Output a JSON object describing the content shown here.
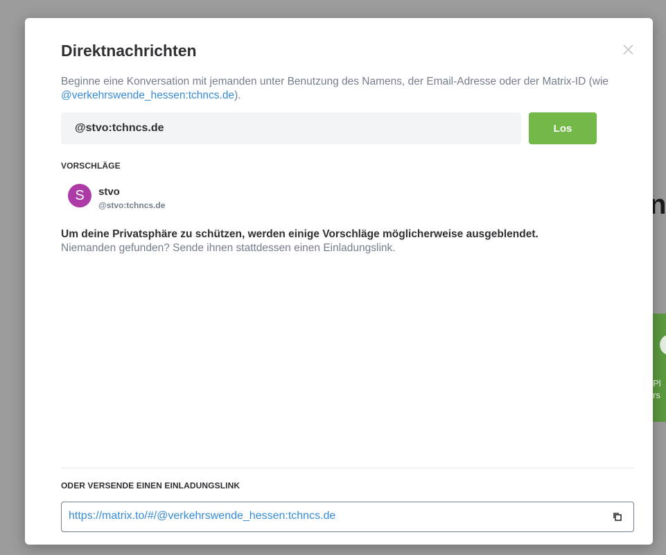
{
  "background": {
    "heading_fragment": "na",
    "card_text_line1": "Pl",
    "card_text_line2": "rs"
  },
  "dialog": {
    "title": "Direktnachrichten",
    "close_icon": "close-icon",
    "description_prefix": "Beginne eine Konversation mit jemanden unter Benutzung des Namens, der Email-Adresse oder der Matrix-ID (wie ",
    "description_example_id": "@verkehrswende_hessen:tchncs.de",
    "description_suffix": ").",
    "search": {
      "value": "@stvo:tchncs.de",
      "placeholder": ""
    },
    "go_button_label": "Los",
    "suggestions_heading": "VORSCHLÄGE",
    "suggestions": [
      {
        "avatar_letter": "S",
        "avatar_color": "#ac3ba8",
        "name": "stvo",
        "user_id": "@stvo:tchncs.de"
      }
    ],
    "privacy_note": "Um deine Privatsphäre zu schützen, werden einige Vorschläge möglicherweise ausgeblendet.",
    "nobody_found": "Niemanden gefunden? Sende ihnen stattdessen einen Einladungslink.",
    "invite_heading": "ODER VERSENDE EINEN EINLADUNGSLINK",
    "invite_link": "https://matrix.to/#/@verkehrswende_hessen:tchncs.de",
    "copy_icon": "copy-icon"
  },
  "colors": {
    "accent_green": "#75b84a",
    "link_blue": "#368bd6",
    "muted_text": "#737d8c",
    "primary_text": "#2e2f32"
  }
}
